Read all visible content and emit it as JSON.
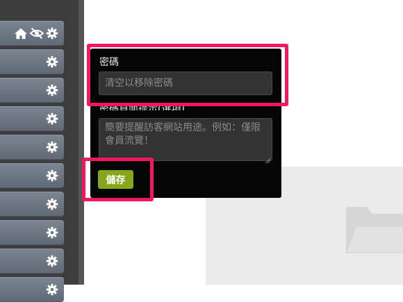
{
  "sidebar": {
    "items": [
      {
        "icons": [
          "home-icon",
          "eye-slash-icon",
          "gear-icon"
        ]
      },
      {
        "icons": [
          "gear-icon"
        ]
      },
      {
        "icons": [
          "gear-icon"
        ]
      },
      {
        "icons": [
          "gear-icon"
        ]
      },
      {
        "icons": [
          "gear-icon"
        ]
      },
      {
        "icons": [
          "gear-icon"
        ]
      },
      {
        "icons": [
          "gear-icon"
        ]
      },
      {
        "icons": [
          "gear-icon"
        ]
      },
      {
        "icons": [
          "gear-icon"
        ]
      },
      {
        "icons": [
          "gear-icon"
        ]
      }
    ]
  },
  "password_panel": {
    "password_label": "密碼",
    "password_placeholder": "清空以移除密碼",
    "hint_label": "密碼頁面提示(選項)",
    "hint_placeholder": "簡要提醒訪客網站用途。例如：僅限會員流覽！",
    "save_label": "儲存"
  },
  "background": {
    "icon": "folder-icon"
  },
  "colors": {
    "highlight": "#f4175f",
    "save_button": "#86a61c",
    "panel_bg": "#050505",
    "sidebar_bg": "#3d3d3d"
  }
}
